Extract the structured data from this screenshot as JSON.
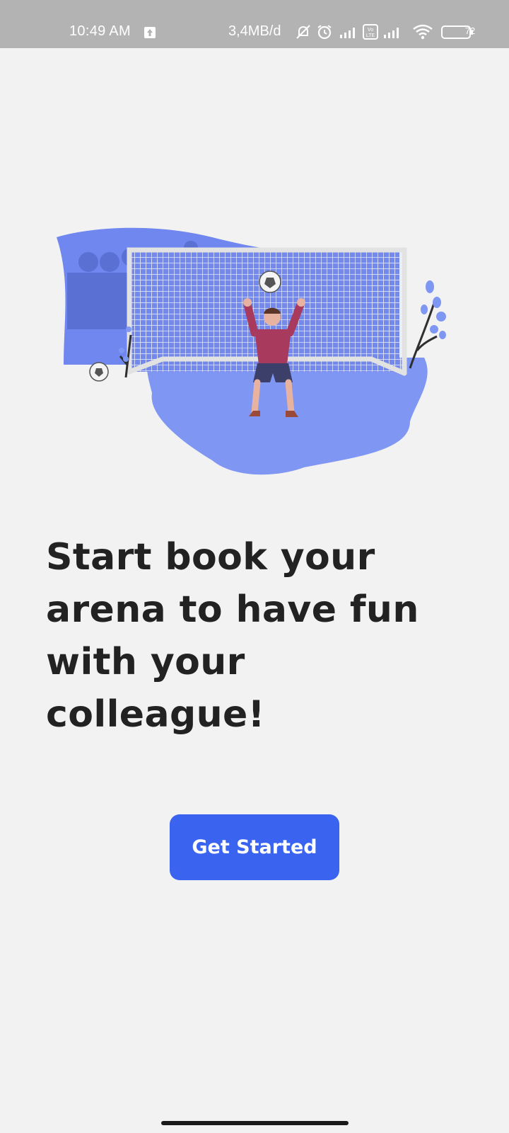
{
  "status_bar": {
    "time": "10:49 AM",
    "speed": "3,4MB/d",
    "battery": "72",
    "icons": [
      "upload-icon",
      "silent-icon",
      "alarm-icon",
      "signal-icon",
      "volte-icon",
      "signal-icon",
      "wifi-icon",
      "battery-icon"
    ]
  },
  "onboarding": {
    "illustration": "goalkeeper-illustration",
    "headline": "Start book your arena to have fun with your colleague!",
    "cta_label": "Get Started"
  },
  "colors": {
    "accent": "#3a64f0",
    "illustration_blue": "#6e86f0",
    "background": "#f2f2f2"
  }
}
